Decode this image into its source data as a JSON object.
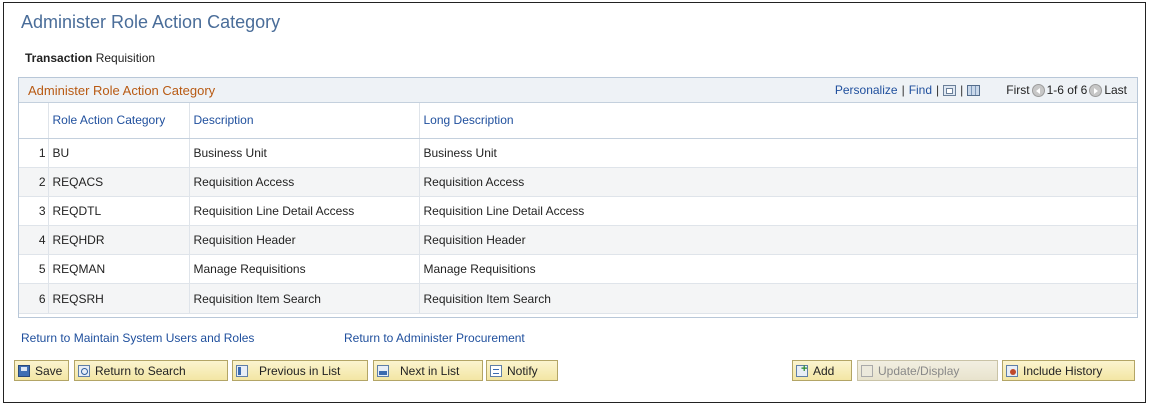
{
  "page": {
    "title": "Administer Role Action Category",
    "transaction_label": "Transaction",
    "transaction_value": "Requisition"
  },
  "grid": {
    "title": "Administer Role Action Category",
    "personalize": "Personalize",
    "find": "Find",
    "sep": "|",
    "first": "First",
    "range": "1-6 of 6",
    "last": "Last",
    "columns": [
      "Role Action Category",
      "Description",
      "Long Description"
    ],
    "rows": [
      {
        "num": "1",
        "category": "BU",
        "description": "Business Unit",
        "long_description": "Business Unit"
      },
      {
        "num": "2",
        "category": "REQACS",
        "description": "Requisition Access",
        "long_description": "Requisition Access"
      },
      {
        "num": "3",
        "category": "REQDTL",
        "description": "Requisition Line Detail Access",
        "long_description": "Requisition Line Detail Access"
      },
      {
        "num": "4",
        "category": "REQHDR",
        "description": "Requisition Header",
        "long_description": "Requisition Header"
      },
      {
        "num": "5",
        "category": "REQMAN",
        "description": "Manage Requisitions",
        "long_description": "Manage Requisitions"
      },
      {
        "num": "6",
        "category": "REQSRH",
        "description": "Requisition Item Search",
        "long_description": "Requisition Item Search"
      }
    ]
  },
  "links": {
    "return_users": "Return to Maintain System Users and Roles",
    "return_procurement": "Return to Administer Procurement"
  },
  "toolbar": {
    "save": "Save",
    "return_search": "Return to Search",
    "previous": "Previous in List",
    "next": "Next in List",
    "notify": "Notify",
    "add": "Add",
    "update": "Update/Display",
    "history": "Include History"
  },
  "icons": {
    "save": "save-icon",
    "return_search": "search-icon",
    "previous": "previous-icon",
    "next": "next-icon",
    "notify": "notify-icon",
    "add": "add-icon",
    "update": "update-icon",
    "history": "history-icon"
  },
  "colors": {
    "title": "#4a6d99",
    "grid_title": "#b85a13",
    "link": "#1f4f9d",
    "button_bg": "#f3e6a4"
  }
}
